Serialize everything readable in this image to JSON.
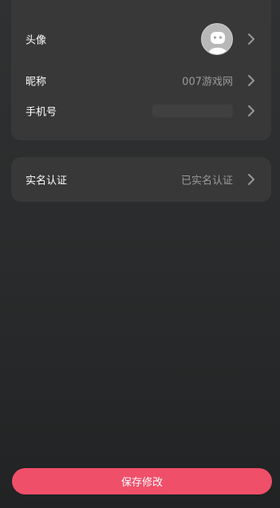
{
  "profile": {
    "avatar": {
      "label": "头像",
      "icon": "avatar-robot-icon"
    },
    "nickname": {
      "label": "昵称",
      "value": "007游戏网"
    },
    "phone": {
      "label": "手机号"
    }
  },
  "verification": {
    "label": "实名认证",
    "value": "已实名认证"
  },
  "actions": {
    "save_label": "保存修改"
  },
  "colors": {
    "card_background": "#383838",
    "page_background": "#2a2c2d",
    "primary_button": "#f04f69",
    "secondary_text": "#9a9a9a"
  }
}
